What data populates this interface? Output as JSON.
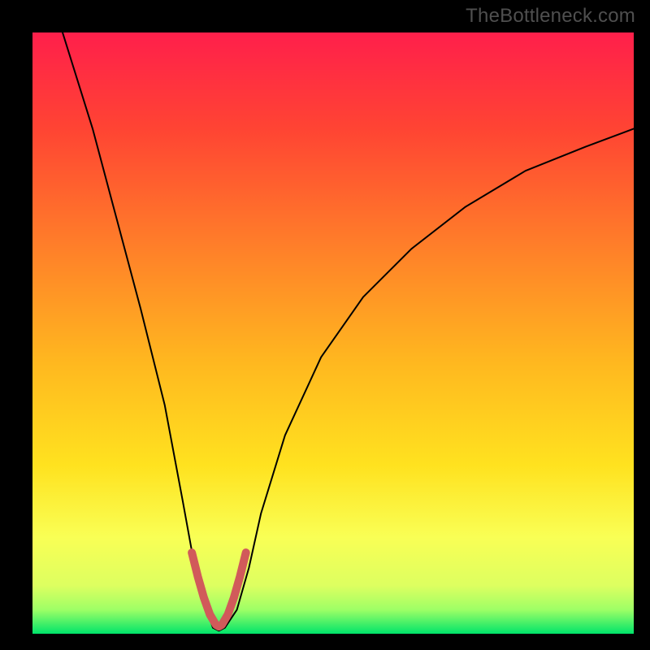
{
  "watermark": "TheBottleneck.com",
  "chart_data": {
    "type": "line",
    "title": "",
    "xlabel": "",
    "ylabel": "",
    "xlim": [
      0,
      100
    ],
    "ylim": [
      0,
      100
    ],
    "grid": false,
    "legend": false,
    "background_gradient": {
      "top": "#ff1f4b",
      "upper_mid": "#ff7a2a",
      "mid": "#ffd21f",
      "lower_mid": "#f6ff66",
      "near_bottom": "#b8ff6a",
      "bottom": "#00e46a"
    },
    "series": [
      {
        "name": "curve",
        "color": "#000000",
        "stroke_width": 2,
        "x": [
          5,
          10,
          14,
          18,
          22,
          25,
          27,
          29,
          30,
          31,
          32,
          34,
          36,
          38,
          42,
          48,
          55,
          63,
          72,
          82,
          92,
          100
        ],
        "values": [
          100,
          84,
          69,
          54,
          38,
          22,
          11,
          4,
          1,
          0.5,
          1,
          4,
          11,
          20,
          33,
          46,
          56,
          64,
          71,
          77,
          81,
          84
        ]
      },
      {
        "name": "highlight-band",
        "color": "#d15a5a",
        "stroke_width": 10,
        "x": [
          26.5,
          27.5,
          28.5,
          29.5,
          30.5,
          31.0,
          31.5,
          32.5,
          33.5,
          34.5,
          35.5
        ],
        "values": [
          13.5,
          9.5,
          6,
          3.2,
          1.5,
          1.2,
          1.5,
          3.2,
          6,
          9.5,
          13.5
        ]
      }
    ],
    "annotations": []
  }
}
